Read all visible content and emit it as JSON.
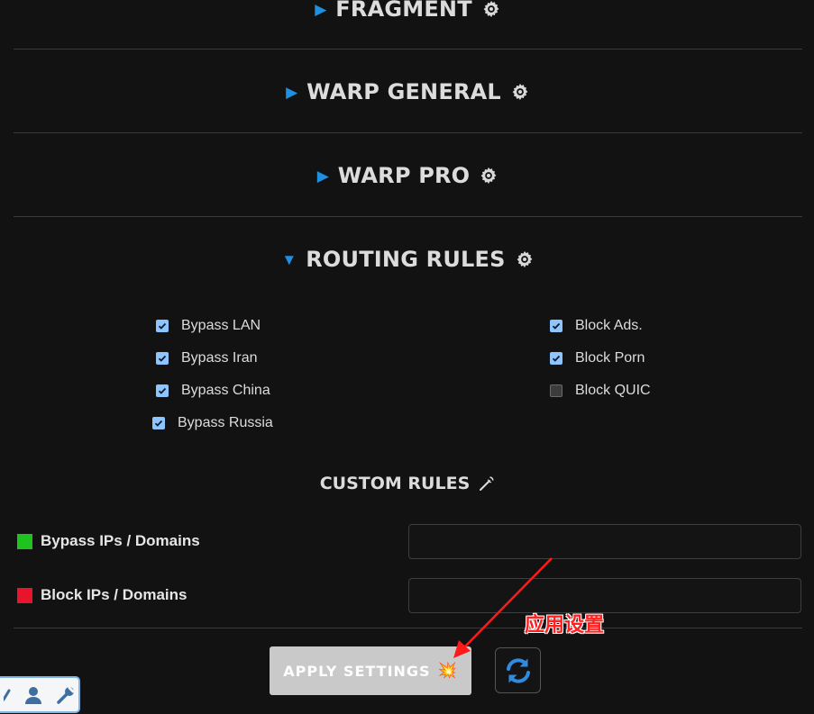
{
  "sections": {
    "fragment": {
      "title": "FRAGMENT",
      "expanded": false
    },
    "warp_general": {
      "title": "WARP GENERAL",
      "expanded": false
    },
    "warp_pro": {
      "title": "WARP PRO",
      "expanded": false
    },
    "routing_rules": {
      "title": "ROUTING RULES",
      "expanded": true
    }
  },
  "routing": {
    "left": [
      {
        "label": "Bypass LAN",
        "checked": true
      },
      {
        "label": "Bypass Iran",
        "checked": true
      },
      {
        "label": "Bypass China",
        "checked": true
      },
      {
        "label": "Bypass Russia",
        "checked": true
      }
    ],
    "right": [
      {
        "label": "Block Ads.",
        "checked": true
      },
      {
        "label": "Block Porn",
        "checked": true
      },
      {
        "label": "Block QUIC",
        "checked": false
      }
    ]
  },
  "custom_rules": {
    "title": "CUSTOM RULES",
    "bypass": {
      "label": "Bypass IPs / Domains",
      "color": "#1ec31e",
      "value": ""
    },
    "block": {
      "label": "Block IPs / Domains",
      "color": "#e8142c",
      "value": ""
    }
  },
  "buttons": {
    "apply_label": "APPLY SETTINGS",
    "apply_emoji": "💥"
  },
  "annotation": {
    "text": "应用设置",
    "color": "#ff2020"
  },
  "colors": {
    "accent": "#1f8fe0",
    "background": "#121212",
    "checkbox": "#8ec5ff"
  },
  "icons": {
    "section_gear": "gear-icon",
    "section_toggle": "triangle-icon",
    "custom_rules": "wrench-icon",
    "refresh": "refresh-icon",
    "toolbar": [
      "user-icon",
      "wrench-icon"
    ]
  }
}
